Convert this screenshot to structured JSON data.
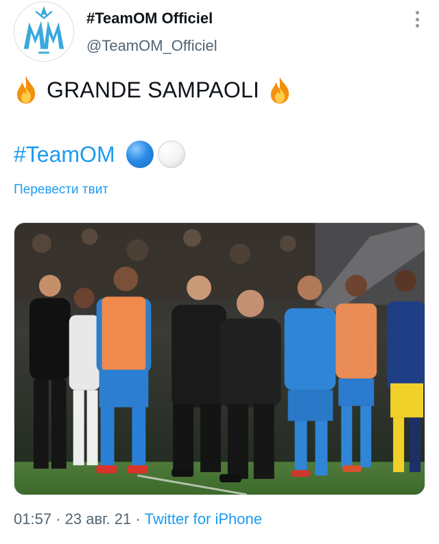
{
  "account": {
    "display_name": "#TeamOM Officiel",
    "handle": "@TeamOM_Officiel",
    "avatar_icon": "om-logo-icon",
    "more_icon": "more-vertical-icon"
  },
  "tweet": {
    "text": "GRANDE SAMPAOLI",
    "emoji_icon": "fire-icon",
    "hashtag": "#TeamOM",
    "flag_icons": [
      "blue-circle-icon",
      "white-circle-icon"
    ],
    "translate_label": "Перевести твит",
    "media_icon": "photo-team-crowd"
  },
  "meta": {
    "time": "01:57",
    "separator": "·",
    "date": "23 авг. 21",
    "source": "Twitter for iPhone"
  },
  "colors": {
    "link": "#1d9bf0",
    "secondary": "#536471",
    "text": "#0f1419",
    "om_blue": "#2aa8e0"
  }
}
